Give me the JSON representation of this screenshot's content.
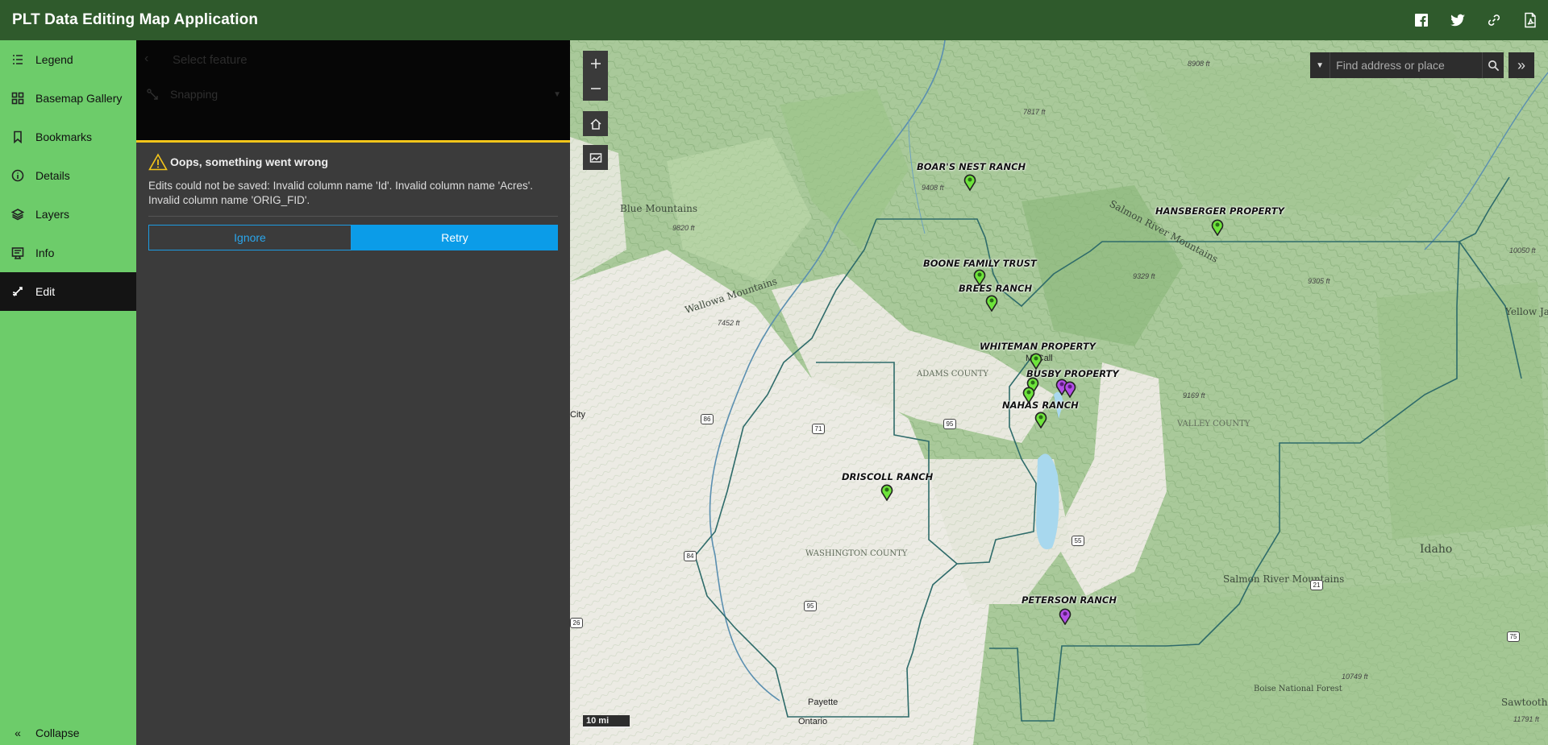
{
  "header": {
    "title": "PLT Data Editing Map Application",
    "icons": [
      "facebook-icon",
      "twitter-icon",
      "link-icon",
      "pdf-icon"
    ]
  },
  "sidebar": {
    "items": [
      {
        "label": "Legend",
        "icon": "legend-icon"
      },
      {
        "label": "Basemap Gallery",
        "icon": "basemap-icon"
      },
      {
        "label": "Bookmarks",
        "icon": "bookmark-icon"
      },
      {
        "label": "Details",
        "icon": "info-circle-icon"
      },
      {
        "label": "Layers",
        "icon": "layers-icon"
      },
      {
        "label": "Info",
        "icon": "info-panel-icon"
      },
      {
        "label": "Edit",
        "icon": "edit-icon",
        "active": true
      }
    ],
    "collapse_label": "Collapse"
  },
  "panel": {
    "select_feature": "Select feature",
    "snapping_label": "Snapping",
    "error": {
      "title": "Oops, something went wrong",
      "message": "Edits could not be saved: Invalid column name 'Id'. Invalid column name 'Acres'. Invalid column name 'ORIG_FID'.",
      "ignore_label": "Ignore",
      "retry_label": "Retry"
    }
  },
  "map": {
    "search_placeholder": "Find address or place",
    "scale_label": "10 mi",
    "ranches": [
      {
        "name": "BOAR'S NEST RANCH",
        "pin": "green"
      },
      {
        "name": "HANSBERGER PROPERTY",
        "pin": "green"
      },
      {
        "name": "BOONE FAMILY TRUST",
        "pin": "green"
      },
      {
        "name": "BREES RANCH",
        "pin": "green"
      },
      {
        "name": "WHITEMAN PROPERTY",
        "pin": "green"
      },
      {
        "name": "BUSBY PROPERTY",
        "pin": "purple"
      },
      {
        "name": "NAHAS RANCH",
        "pin": "green"
      },
      {
        "name": "DRISCOLL RANCH",
        "pin": "green"
      },
      {
        "name": "PETERSON RANCH",
        "pin": "purple"
      }
    ],
    "counties": [
      "ADAMS COUNTY",
      "VALLEY COUNTY",
      "WASHINGTON COUNTY"
    ],
    "terrain": [
      "Blue Mountains",
      "Wallowa Mountains",
      "Salmon River Mountains",
      "Salmon River Mountains",
      "Yellow Jacket Mountains",
      "Sawtooth Range",
      "Boise National Forest",
      "Idaho"
    ],
    "towns": [
      "McCall",
      "City",
      "Payette",
      "Ontario"
    ],
    "elevations": [
      "9408 ft",
      "9820 ft",
      "7452 ft",
      "7817 ft",
      "8908 ft",
      "9329 ft",
      "9305 ft",
      "10050 ft",
      "9169 ft",
      "10749 ft",
      "11791 ft"
    ],
    "routes": [
      "86",
      "71",
      "95",
      "84",
      "95",
      "26",
      "55",
      "21",
      "75"
    ],
    "colors": {
      "pin_green": "#6ee43b",
      "pin_purple": "#b34ee6",
      "boundary": "#2e6b6a",
      "header": "#2f5a2c",
      "sidebar": "#6dcc6a",
      "accent": "#0b9ce8",
      "warning": "#f3c51a"
    }
  }
}
